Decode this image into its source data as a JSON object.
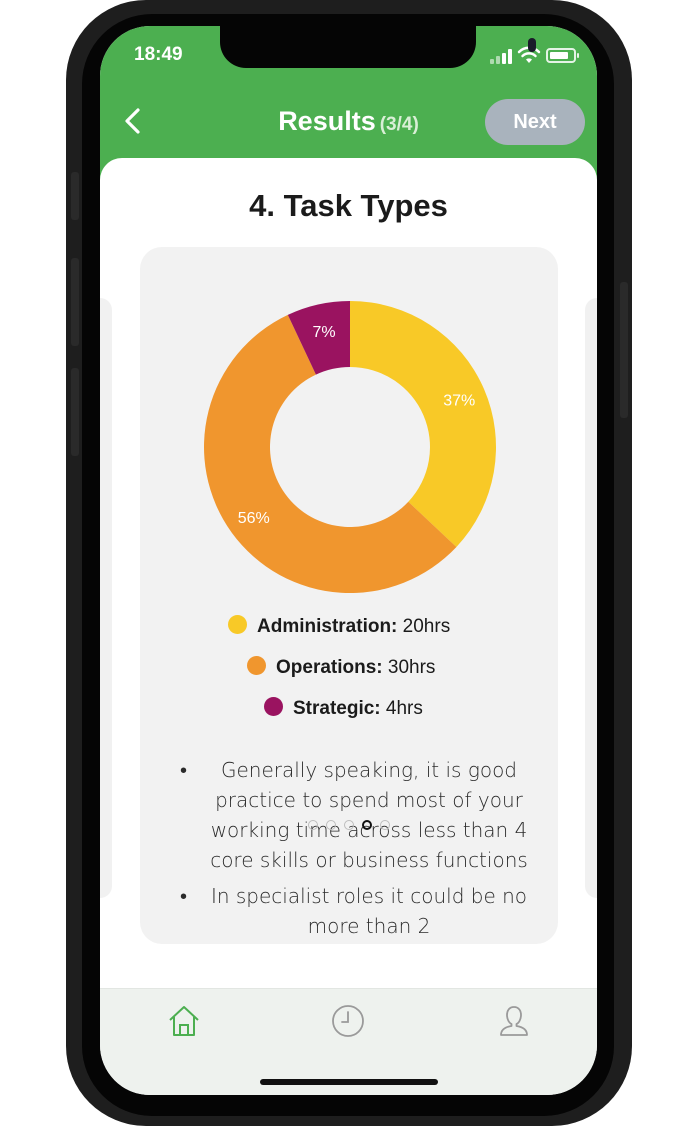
{
  "status_bar": {
    "time": "18:49"
  },
  "header": {
    "title": "Results",
    "step": "(3/4)",
    "next_label": "Next",
    "back_icon": "chevron-left-icon"
  },
  "section": {
    "title": "4. Task Types"
  },
  "chart_data": {
    "type": "pie",
    "style": "donut",
    "labels": [
      "Administration",
      "Operations",
      "Strategic"
    ],
    "values": [
      37,
      56,
      7
    ],
    "value_labels": [
      "37%",
      "56%",
      "7%"
    ],
    "colors": [
      "#f8c927",
      "#f0962e",
      "#9a1360"
    ]
  },
  "legend": [
    {
      "name": "Administration:",
      "value": "20hrs",
      "color": "#f8c927"
    },
    {
      "name": "Operations:",
      "value": "30hrs",
      "color": "#f0962e"
    },
    {
      "name": "Strategic:",
      "value": "4hrs",
      "color": "#9a1360"
    }
  ],
  "notes": [
    "Generally speaking, it is good practice to spend most of your working time across less than 4 core skills or business functions",
    "In specialist roles it could be no more than 2"
  ],
  "pager": {
    "count": 5,
    "active_index": 3
  },
  "tabbar": {
    "items": [
      {
        "icon": "home-icon",
        "active": true
      },
      {
        "icon": "clock-icon",
        "active": false
      },
      {
        "icon": "user-icon",
        "active": false
      }
    ]
  },
  "colors": {
    "brand_green": "#4caf50",
    "next_disabled": "#a9b3bd"
  }
}
